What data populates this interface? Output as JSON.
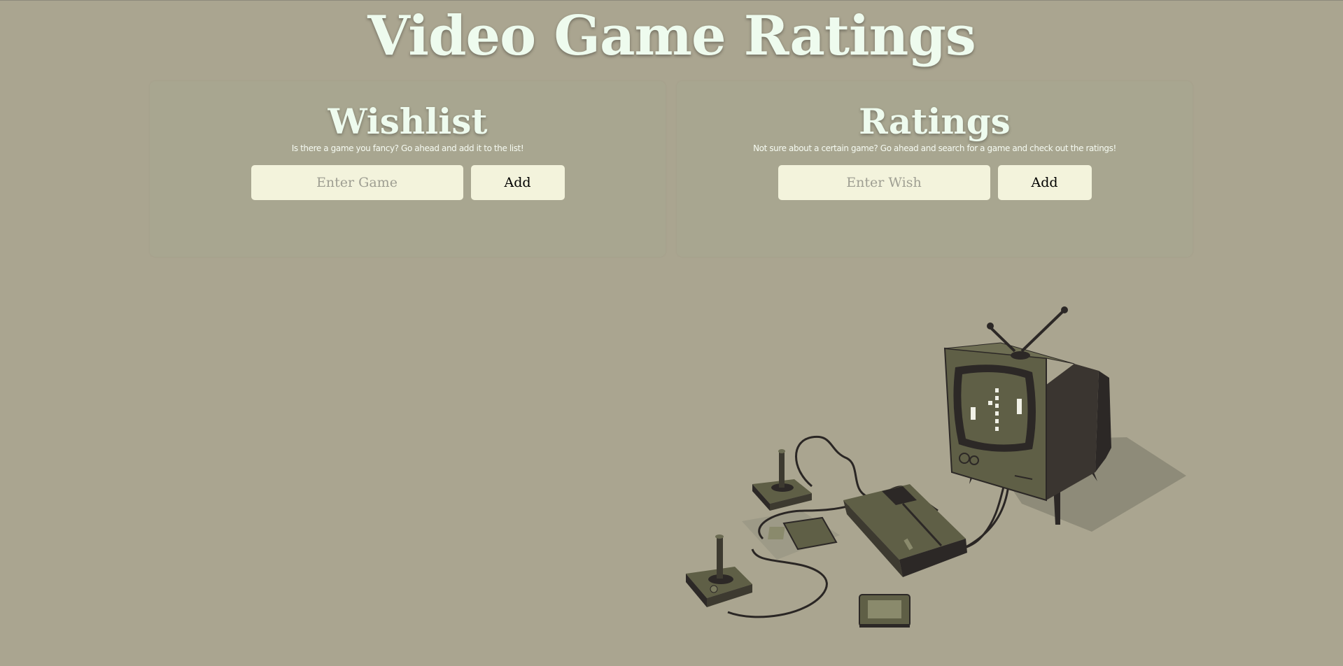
{
  "page": {
    "title": "Video Game Ratings"
  },
  "wishlist": {
    "title": "Wishlist",
    "subtitle": "Is there a game you fancy? Go ahead and add it to the list!",
    "input_placeholder": "Enter Game",
    "input_value": "",
    "button_label": "Add"
  },
  "ratings": {
    "title": "Ratings",
    "subtitle": "Not sure about a certain game? Go ahead and search for a game and check out the ratings!",
    "input_placeholder": "Enter Wish",
    "input_value": "",
    "button_label": "Add"
  },
  "colors": {
    "background": "#aaa590",
    "panel": "#a8a690",
    "title_text": "#eefbee",
    "input_bg": "#f3f3dc",
    "illustration_dark": "#282322",
    "illustration_olive": "#5f5f46"
  },
  "icons": {
    "illustration": "retro-tv-console-illustration-icon"
  }
}
